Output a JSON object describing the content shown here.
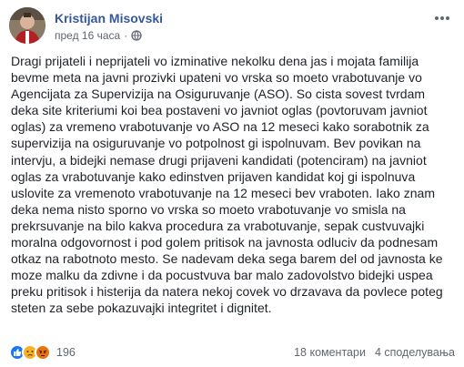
{
  "post": {
    "author": "Kristijan Misovski",
    "timestamp": "пред 16 часа",
    "separator": "·",
    "audience_icon": "globe-icon",
    "more_icon": "more-options-icon",
    "body": "Dragi prijateli i neprijateli vo izminative nekolku dena jas i mojata familija bevme meta na javni prozivki upateni vo vrska so moeto vrabotuvanje vo Agencijata za Supervizija na Osiguruvanje (ASO). So cista sovest tvrdam deka site kriteriumi koi bea postaveni vo javniot oglas (povtoruvam javniot oglas) za vremeno vrabotuvanje vo ASO na 12 meseci kako sorabotnik za supervizija na osiguruvanje vo potpolnost gi ispolnuvam. Bev povikan na intervju, a bidejki nemase drugi prijaveni kandidati (potenciram) na javniot oglas za vrabotuvanje kako edinstven prijaven kandidat koj gi ispolnuva uslovite za vremenoto vrabotuvanje na 12 meseci bev vraboten. Iako znam deka nema nisto sporno vo vrska so moeto vrabotuvanje vo smisla na prekrsuvanje na bilo kakva procedura za vrabotuvanje, sepak custvuvajki moralna odgovornost i pod golem pritisok na javnosta odluciv da podnesam otkaz na rabotnoto mesto. Se nadevam deka sega barem del od javnosta ke moze malku da zdivne i da pocustvuva bar malo zadovolstvo bidejki uspea preku pritisok i histerija da natera nekoj covek vo drzavava da povlece poteg steten za sebe pokazuvajki integritet i dignitet."
  },
  "footer": {
    "reactions": [
      "like-reaction-icon",
      "sad-reaction-icon",
      "angry-reaction-icon"
    ],
    "reaction_count": "196",
    "comments": "18 коментари",
    "shares": "4 споделувања"
  },
  "colors": {
    "author": "#365899",
    "meta": "#616770",
    "text": "#1d2129",
    "like": "#1877f2",
    "sad": "#f7b125",
    "angry": "#e9710f"
  }
}
